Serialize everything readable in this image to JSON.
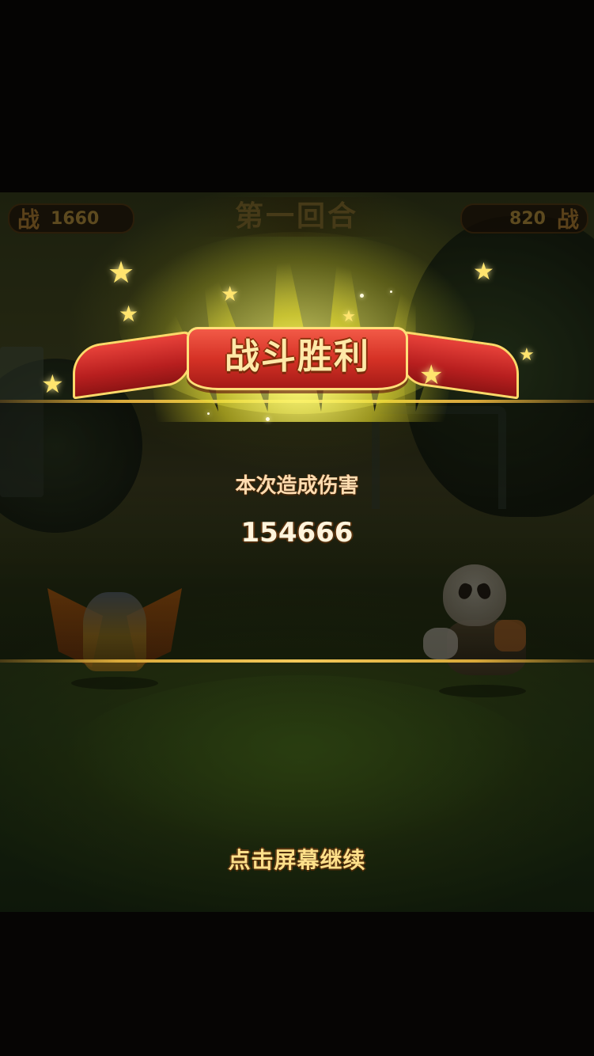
{
  "hud": {
    "left_icon": "战",
    "left_power": "1660",
    "round_title": "第一回合",
    "right_power": "820",
    "right_icon": "战"
  },
  "result": {
    "banner_title": "战斗胜利",
    "damage_label": "本次造成伤害",
    "damage_value": "154666"
  },
  "prompt": {
    "continue_text": "点击屏幕继续"
  },
  "colors": {
    "ribbon": "#d63226",
    "gold_text": "#ffe08a",
    "glow": "#fffa78"
  },
  "icons": {
    "star": "star-icon",
    "power": "battle-power-icon"
  }
}
